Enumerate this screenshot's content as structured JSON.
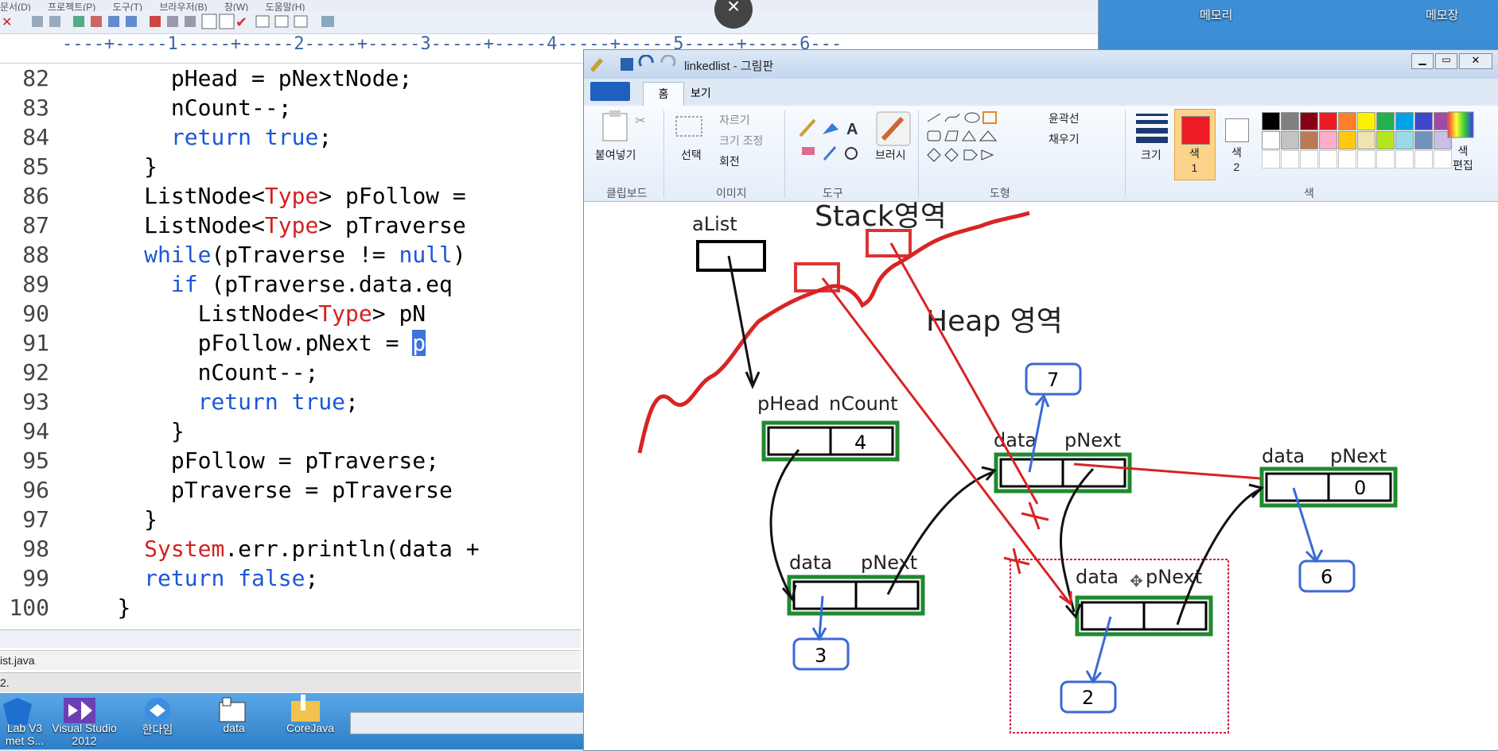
{
  "desktop": {
    "icons_top": [
      "메모리",
      "메모장"
    ],
    "taskbar_icons": [
      "Lab V3\nmet S...",
      "Visual Studio\n2012",
      "한다임",
      "data",
      "CoreJava"
    ]
  },
  "editor": {
    "menu": [
      "문서(D)",
      "프로젝트(P)",
      "도구(T)",
      "브라우저(B)",
      "창(W)",
      "도움말(H)"
    ],
    "ruler": "----+-----1-----+-----2-----+-----3-----+-----4-----+-----5-----+-----6---",
    "lines": [
      {
        "n": "82",
        "indent": "        ",
        "segs": [
          [
            "t",
            "pHead = pNextNode;"
          ]
        ]
      },
      {
        "n": "83",
        "indent": "        ",
        "segs": [
          [
            "t",
            "nCount--;"
          ]
        ]
      },
      {
        "n": "84",
        "indent": "        ",
        "segs": [
          [
            "k",
            "return"
          ],
          [
            "t",
            " "
          ],
          [
            "k",
            "true"
          ],
          [
            "t",
            ";"
          ]
        ]
      },
      {
        "n": "85",
        "indent": "      ",
        "segs": [
          [
            "t",
            "}"
          ]
        ]
      },
      {
        "n": "86",
        "indent": "      ",
        "segs": [
          [
            "t",
            "ListNode<"
          ],
          [
            "y",
            "Type"
          ],
          [
            "t",
            "> pFollow = "
          ]
        ]
      },
      {
        "n": "87",
        "indent": "      ",
        "segs": [
          [
            "t",
            "ListNode<"
          ],
          [
            "y",
            "Type"
          ],
          [
            "t",
            "> pTraverse "
          ]
        ]
      },
      {
        "n": "88",
        "indent": "      ",
        "segs": [
          [
            "k",
            "while"
          ],
          [
            "t",
            "(pTraverse != "
          ],
          [
            "k",
            "null"
          ],
          [
            "t",
            ")"
          ]
        ]
      },
      {
        "n": "89",
        "indent": "        ",
        "segs": [
          [
            "k",
            "if"
          ],
          [
            "t",
            " (pTraverse.data.eq"
          ]
        ]
      },
      {
        "n": "90",
        "indent": "          ",
        "segs": [
          [
            "t",
            "ListNode<"
          ],
          [
            "y",
            "Type"
          ],
          [
            "t",
            "> pN"
          ]
        ]
      },
      {
        "n": "91",
        "indent": "          ",
        "segs": [
          [
            "t",
            "pFollow.pNext = "
          ],
          [
            "s",
            "p"
          ]
        ]
      },
      {
        "n": "92",
        "indent": "          ",
        "segs": [
          [
            "t",
            "nCount--;"
          ]
        ]
      },
      {
        "n": "93",
        "indent": "          ",
        "segs": [
          [
            "k",
            "return"
          ],
          [
            "t",
            " "
          ],
          [
            "k",
            "true"
          ],
          [
            "t",
            ";"
          ]
        ]
      },
      {
        "n": "94",
        "indent": "        ",
        "segs": [
          [
            "t",
            "}"
          ]
        ]
      },
      {
        "n": "95",
        "indent": "        ",
        "segs": [
          [
            "t",
            "pFollow = pTraverse;"
          ]
        ]
      },
      {
        "n": "96",
        "indent": "        ",
        "segs": [
          [
            "t",
            "pTraverse = pTraverse"
          ]
        ]
      },
      {
        "n": "97",
        "indent": "      ",
        "segs": [
          [
            "t",
            "}"
          ]
        ]
      },
      {
        "n": "98",
        "indent": "      ",
        "segs": [
          [
            "y",
            "System"
          ],
          [
            "t",
            ".err.println(data +"
          ]
        ]
      },
      {
        "n": "99",
        "indent": "      ",
        "segs": [
          [
            "k",
            "return"
          ],
          [
            "t",
            " "
          ],
          [
            "k",
            "false"
          ],
          [
            "t",
            ";"
          ]
        ]
      },
      {
        "n": "100",
        "indent": "    ",
        "segs": [
          [
            "t",
            "}"
          ]
        ]
      }
    ],
    "tab_label": "ist.java",
    "status_text": "2."
  },
  "paint": {
    "title": "linkedlist - 그림판",
    "tabs": [
      "홈",
      "보기"
    ],
    "ribbon": {
      "paste": "붙여넣기",
      "select": "선택",
      "cut": "자르기",
      "resize": "크기 조정",
      "rotate": "회전",
      "brush": "브러시",
      "outline": "윤곽선",
      "fill": "채우기",
      "size": "크기",
      "color1": "색\n1",
      "color2": "색\n2",
      "edit_colors": "색\n편집",
      "groups": [
        "클립보드",
        "이미지",
        "도구",
        "도형",
        "색"
      ]
    },
    "palette": [
      "#000000",
      "#7f7f7f",
      "#880015",
      "#ed1c24",
      "#ff7f27",
      "#fff200",
      "#22b14c",
      "#00a2e8",
      "#3f48cc",
      "#a349a4",
      "#ffffff",
      "#c3c3c3",
      "#b97a57",
      "#ffaec9",
      "#ffc90e",
      "#efe4b0",
      "#b5e61d",
      "#99d9ea",
      "#7092be",
      "#c8bfe7"
    ],
    "diagram": {
      "stack_label": "Stack영역",
      "heap_label": "Heap 영역",
      "alist": "aList",
      "head_fields": [
        "pHead",
        "nCount"
      ],
      "count_value": "4",
      "data_label": "data",
      "pnext_label": "pNext",
      "values": [
        "3",
        "7",
        "2",
        "6"
      ],
      "last_next": "0"
    }
  }
}
